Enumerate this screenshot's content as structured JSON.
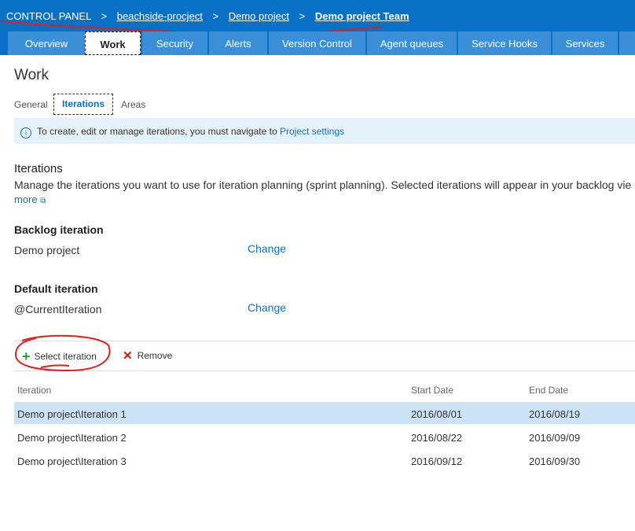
{
  "breadcrumb": {
    "root": "CONTROL PANEL",
    "sep": ">",
    "collection": "beachside-procject",
    "project": "Demo project",
    "team": "Demo project Team"
  },
  "tabs": [
    {
      "label": "Overview"
    },
    {
      "label": "Work"
    },
    {
      "label": "Security"
    },
    {
      "label": "Alerts"
    },
    {
      "label": "Version Control"
    },
    {
      "label": "Agent queues"
    },
    {
      "label": "Service Hooks"
    },
    {
      "label": "Services"
    }
  ],
  "page": {
    "title": "Work",
    "subtabs": [
      "General",
      "Iterations",
      "Areas"
    ]
  },
  "info": {
    "text": "To create, edit or manage iterations, you must navigate to",
    "link": "Project settings"
  },
  "iterations": {
    "heading": "Iterations",
    "description": "Manage the iterations you want to use for iteration planning (sprint planning). Selected iterations will appear in your backlog vie",
    "more": "more"
  },
  "backlog": {
    "label": "Backlog iteration",
    "value": "Demo project",
    "change": "Change"
  },
  "default_iteration": {
    "label": "Default iteration",
    "value": "@CurrentIteration",
    "change": "Change"
  },
  "toolbar": {
    "select": "Select iteration",
    "remove": "Remove"
  },
  "table": {
    "columns": [
      "Iteration",
      "Start Date",
      "End Date"
    ],
    "rows": [
      {
        "iteration": "Demo project\\Iteration 1",
        "start": "2016/08/01",
        "end": "2016/08/19"
      },
      {
        "iteration": "Demo project\\Iteration 2",
        "start": "2016/08/22",
        "end": "2016/09/09"
      },
      {
        "iteration": "Demo project\\Iteration 3",
        "start": "2016/09/12",
        "end": "2016/09/30"
      }
    ]
  },
  "colors": {
    "brand": "#0a72c6",
    "annotation": "#e02020"
  }
}
